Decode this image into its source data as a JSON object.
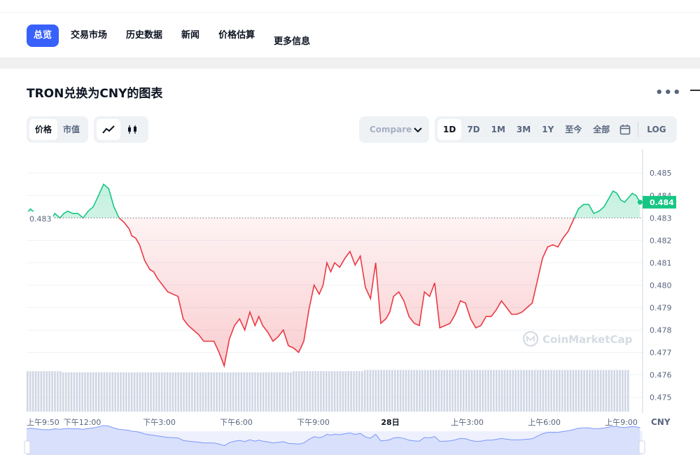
{
  "nav": {
    "tabs": [
      "总览",
      "交易市场",
      "历史数据",
      "新闻",
      "价格估算",
      "更多信息"
    ]
  },
  "title": "TRON兑换为CNY的图表",
  "controls": {
    "metric_tabs": [
      "价格",
      "市值"
    ],
    "compare_label": "Compare",
    "ranges": [
      "1D",
      "7D",
      "1M",
      "3M",
      "1Y",
      "至今",
      "全部"
    ],
    "log_label": "LOG"
  },
  "colors": {
    "accent": "#3861fb",
    "up": "#16c784",
    "down": "#ea3943",
    "volume": "#cfd6e4"
  },
  "watermark": "CoinMarketCap",
  "icons": [
    "line-chart-icon",
    "candlestick-icon",
    "calendar-icon",
    "chevron-down-icon",
    "more-dots-icon",
    "coinmarketcap-logo-icon"
  ],
  "chart_data": {
    "type": "line",
    "baseline_value": 0.483,
    "baseline_label": "0.483",
    "current_value": 0.4837,
    "current_label": "0.484",
    "y_unit": "CNY",
    "ylim": [
      0.4743,
      0.4856
    ],
    "y_ticks": [
      "0.485",
      "0.484",
      "0.483",
      "0.482",
      "0.481",
      "0.480",
      "0.479",
      "0.478",
      "0.477",
      "0.476",
      "0.475"
    ],
    "x_ticks": [
      "上午9:50",
      "下午12:00",
      "下午3:00",
      "下午6:00",
      "下午9:00",
      "28日",
      "上午3:00",
      "上午6:00",
      "上午9:00"
    ],
    "x_range_hours": [
      0,
      24
    ],
    "x_tick_hours": [
      0,
      2.17,
      5.17,
      8.17,
      11.17,
      14.17,
      17.17,
      20.17,
      23.17
    ],
    "series": [
      {
        "x_hours": [
          0,
          0.15,
          0.35,
          0.6,
          0.9,
          1.1,
          1.3,
          1.45,
          1.6,
          1.8,
          2.0,
          2.2,
          2.4,
          2.6,
          2.8,
          3.0,
          3.2,
          3.4,
          3.6,
          3.8,
          4.0,
          4.1,
          4.25,
          4.4,
          4.6,
          4.8,
          4.95,
          5.1,
          5.3,
          5.5,
          5.7,
          5.9,
          6.1,
          6.3,
          6.5,
          6.7,
          6.9,
          7.1,
          7.3,
          7.5,
          7.7,
          7.9,
          8.1,
          8.3,
          8.5,
          8.7,
          8.9,
          9.05,
          9.2,
          9.4,
          9.6,
          9.8,
          10.0,
          10.2,
          10.4,
          10.6,
          10.8,
          11.0,
          11.2,
          11.4,
          11.55,
          11.7,
          11.85,
          12.0,
          12.2,
          12.4,
          12.6,
          12.8,
          13.0,
          13.2,
          13.4,
          13.6,
          13.8,
          14.0,
          14.15,
          14.3,
          14.5,
          14.7,
          14.9,
          15.1,
          15.3,
          15.5,
          15.7,
          15.9,
          16.1,
          16.3,
          16.5,
          16.7,
          16.9,
          17.1,
          17.3,
          17.5,
          17.7,
          17.9,
          18.1,
          18.3,
          18.5,
          18.7,
          18.9,
          19.1,
          19.3,
          19.5,
          19.7,
          19.9,
          20.1,
          20.3,
          20.5,
          20.7,
          20.9,
          21.1,
          21.3,
          21.5,
          21.7,
          21.9,
          22.1,
          22.3,
          22.5,
          22.7,
          22.85,
          23.0,
          23.15,
          23.3,
          23.45,
          23.6,
          23.75,
          23.9
        ],
        "y": [
          0.4832,
          0.4834,
          0.4832,
          0.4829,
          0.4828,
          0.4832,
          0.483,
          0.4832,
          0.4833,
          0.4832,
          0.4832,
          0.483,
          0.4833,
          0.4835,
          0.484,
          0.4845,
          0.4843,
          0.4835,
          0.483,
          0.4828,
          0.4825,
          0.4822,
          0.4821,
          0.4818,
          0.4811,
          0.4807,
          0.4806,
          0.4803,
          0.48,
          0.4797,
          0.4796,
          0.4795,
          0.4785,
          0.4782,
          0.478,
          0.4778,
          0.4775,
          0.4775,
          0.4775,
          0.477,
          0.4764,
          0.4776,
          0.4782,
          0.4785,
          0.478,
          0.4788,
          0.4782,
          0.4786,
          0.4782,
          0.4779,
          0.4775,
          0.4777,
          0.478,
          0.4773,
          0.4772,
          0.477,
          0.4775,
          0.4789,
          0.48,
          0.4796,
          0.48,
          0.481,
          0.4806,
          0.481,
          0.4808,
          0.4812,
          0.4815,
          0.4809,
          0.4813,
          0.4799,
          0.4794,
          0.481,
          0.4783,
          0.4785,
          0.4788,
          0.4795,
          0.4797,
          0.4793,
          0.4786,
          0.4783,
          0.4782,
          0.4797,
          0.4795,
          0.4801,
          0.4781,
          0.4782,
          0.4783,
          0.4787,
          0.4793,
          0.4792,
          0.4785,
          0.4781,
          0.4782,
          0.4786,
          0.4786,
          0.4789,
          0.4793,
          0.479,
          0.4787,
          0.4787,
          0.4788,
          0.479,
          0.4792,
          0.4802,
          0.4812,
          0.4817,
          0.4818,
          0.4817,
          0.4821,
          0.4824,
          0.4829,
          0.4834,
          0.4836,
          0.4836,
          0.4832,
          0.4833,
          0.4835,
          0.4839,
          0.4842,
          0.4841,
          0.4838,
          0.4837,
          0.4839,
          0.4841,
          0.484,
          0.4837
        ],
        "volume": [
          0.34,
          0.34,
          0.34,
          0.34,
          0.34,
          0.34,
          0.34,
          0.33,
          0.33,
          0.33,
          0.33,
          0.33,
          0.33,
          0.33,
          0.33,
          0.33,
          0.33,
          0.33,
          0.33,
          0.33,
          0.33,
          0.33,
          0.33,
          0.33,
          0.33,
          0.33,
          0.33,
          0.33,
          0.33,
          0.33,
          0.33,
          0.33,
          0.33,
          0.33,
          0.33,
          0.33,
          0.33,
          0.33,
          0.33,
          0.33,
          0.33,
          0.33,
          0.33,
          0.33,
          0.33,
          0.33,
          0.33,
          0.33,
          0.33,
          0.33,
          0.33,
          0.33,
          0.33,
          0.33,
          0.33,
          0.34,
          0.34,
          0.34,
          0.34,
          0.34,
          0.34,
          0.34,
          0.34,
          0.34,
          0.34,
          0.34,
          0.34,
          0.34,
          0.34,
          0.34,
          0.35,
          0.35,
          0.35,
          0.35,
          0.35,
          0.35,
          0.35,
          0.35,
          0.35,
          0.35,
          0.35,
          0.35,
          0.35,
          0.35,
          0.35,
          0.35,
          0.35,
          0.35,
          0.35,
          0.35,
          0.35,
          0.35,
          0.35,
          0.35,
          0.35,
          0.35,
          0.35,
          0.35,
          0.35,
          0.35,
          0.35,
          0.35,
          0.35,
          0.35,
          0.35,
          0.35,
          0.35,
          0.35,
          0.35,
          0.35,
          0.35,
          0.35,
          0.35,
          0.35,
          0.35,
          0.35,
          0.35,
          0.35,
          0.35,
          0.35,
          0.35,
          0.35,
          0.35,
          0.35,
          0.35,
          0.35
        ]
      }
    ],
    "navigator": {
      "visible": true,
      "tick_labels_partially_hidden": true
    }
  }
}
